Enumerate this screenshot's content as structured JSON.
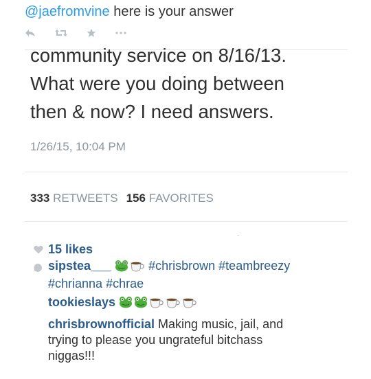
{
  "top_tweet": {
    "mention": "@jaefromvine",
    "text": " here is your answer"
  },
  "actions": {
    "reply_icon": "reply-icon",
    "retweet_icon": "retweet-icon",
    "favorite_icon": "star-icon",
    "more_icon": "more-icon"
  },
  "quoted_tweet": {
    "lines": [
      "community service on 8/16/13.",
      "What were you doing between",
      "then & now? I need answers."
    ],
    "timestamp": "1/26/15, 10:04 PM",
    "retweets_count": "333",
    "retweets_label": "RETWEETS",
    "favorites_count": "156",
    "favorites_label": "FAVORITES"
  },
  "instagram": {
    "likes": "15 likes",
    "comments": [
      {
        "user": "sipstea___",
        "emojis": [
          "frog",
          "tea"
        ],
        "hashtags": [
          "#chrisbrown",
          "#teambreezy",
          "#chrianna",
          "#chrae"
        ]
      },
      {
        "user": "tookieslays",
        "emojis": [
          "frog",
          "frog",
          "tea",
          "tea",
          "tea"
        ]
      },
      {
        "user": "chrisbrownofficial",
        "text": "Making music, jail, and",
        "text2": "trying to please you ungrateful bitchass",
        "text3": "niggas!!!"
      }
    ]
  },
  "colors": {
    "link": "#2b9be3",
    "ig_user": "#2c5c8a",
    "muted": "#8b959d"
  }
}
